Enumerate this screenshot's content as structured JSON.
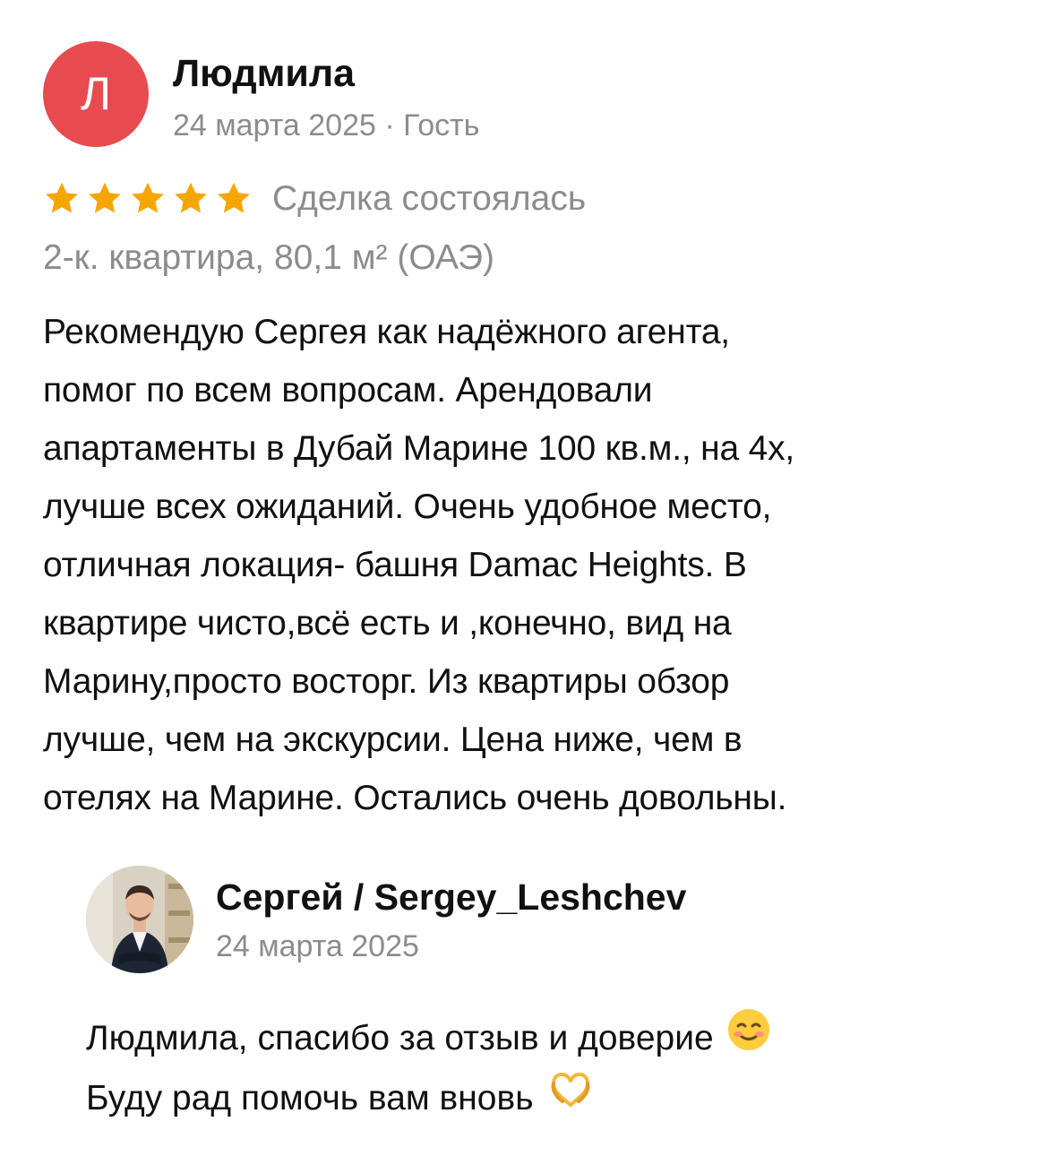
{
  "review": {
    "avatar_letter": "Л",
    "author_name": "Людмила",
    "meta": "24 марта 2025 · Гость",
    "rating": 5,
    "rating_max": 5,
    "star_color": "#f7a600",
    "avatar_color": "#e84b4f",
    "deal_status": "Сделка состоялась",
    "object": "2-к. квартира, 80,1 м² (ОАЭ)",
    "text": "Рекомендую Сергея как надёжного агента,\nпомог по всем вопросам. Арендовали\nапартаменты в Дубай Марине  100 кв.м., на 4х,\nлучше всех ожиданий. Очень удобное место,\nотличная локация- башня Damac Heights. В\nквартире чисто,всё есть и ,конечно, вид на\nМарину,просто восторг. Из квартиры обзор\nлучше, чем на экскурсии.  Цена ниже, чем в\nотелях на Марине. Остались очень довольны."
  },
  "reply": {
    "author_name": "Сергей / Sergey_Leshchev",
    "date": "24 марта 2025",
    "line1": "Людмила, спасибо за отзыв и доверие",
    "line1_emoji": "smiling-face-icon",
    "line2": "Буду рад помочь вам вновь",
    "line2_emoji": "heart-hands-icon"
  }
}
